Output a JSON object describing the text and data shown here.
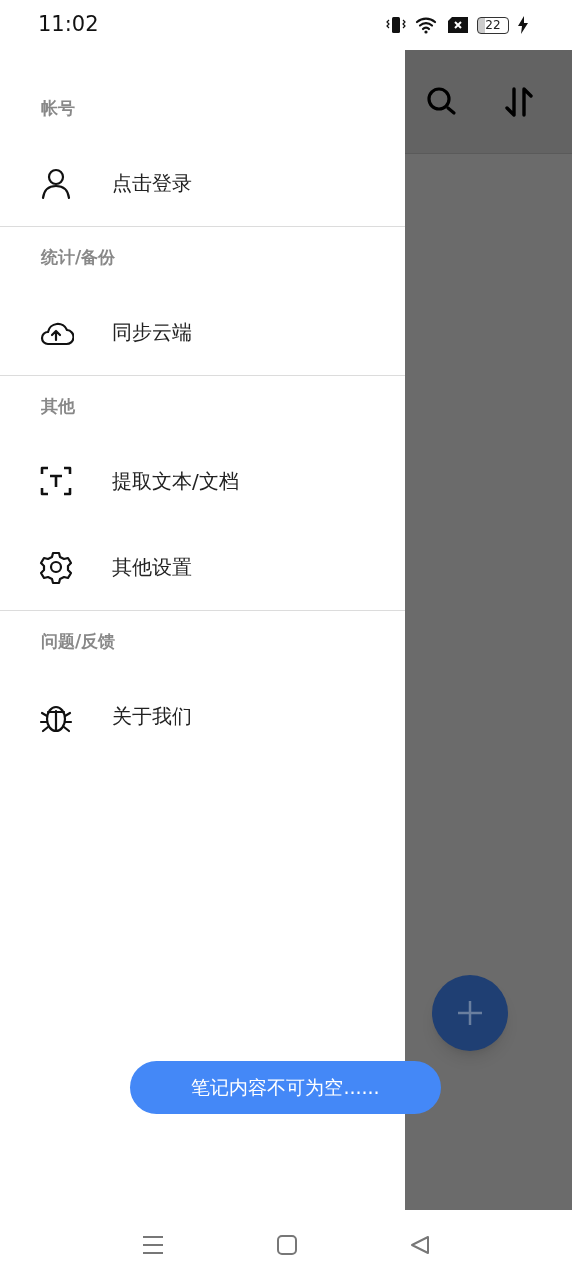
{
  "status_bar": {
    "time": "11:02",
    "battery": "22"
  },
  "drawer": {
    "sections": [
      {
        "title": "帐号",
        "items": [
          {
            "label": "点击登录"
          }
        ]
      },
      {
        "title": "统计/备份",
        "items": [
          {
            "label": "同步云端"
          }
        ]
      },
      {
        "title": "其他",
        "items": [
          {
            "label": "提取文本/文档"
          },
          {
            "label": "其他设置"
          }
        ]
      },
      {
        "title": "问题/反馈",
        "items": [
          {
            "label": "关于我们"
          }
        ]
      }
    ]
  },
  "toast": "笔记内容不可为空......"
}
